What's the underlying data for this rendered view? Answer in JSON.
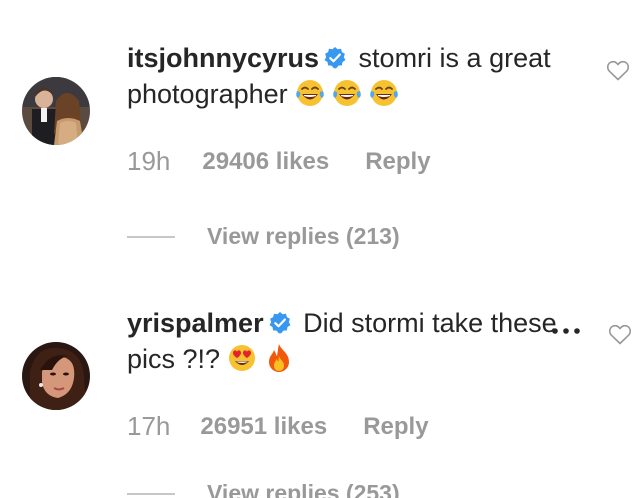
{
  "comments": [
    {
      "username": "itsjohnnycyrus",
      "verified": true,
      "text": "stomri is a great photographer",
      "emojis": [
        "face-with-tears-of-joy",
        "face-with-tears-of-joy",
        "face-with-tears-of-joy"
      ],
      "time": "19h",
      "likes": "29406 likes",
      "reply_label": "Reply",
      "view_replies": "View replies (213)"
    },
    {
      "username": "yrispalmer",
      "verified": true,
      "text": "Did stormi take these pics ?!?",
      "emojis": [
        "smiling-face-with-heart-eyes",
        "fire"
      ],
      "time": "17h",
      "likes": "26951 likes",
      "reply_label": "Reply",
      "view_replies": "View replies (253)"
    }
  ],
  "colors": {
    "text": "#262626",
    "muted": "#999999",
    "verified_blue": "#3897f0",
    "divider": "#c7c7c7"
  },
  "icons": [
    "heart-outline-icon",
    "more-options-icon",
    "verified-badge-icon"
  ]
}
